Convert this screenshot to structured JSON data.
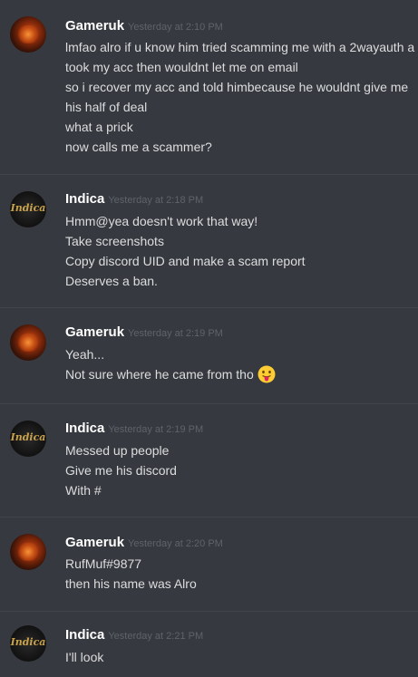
{
  "messages": [
    {
      "author": "Gameruk",
      "timestamp": "Yesterday at 2:10 PM",
      "lines": [
        "lmfao alro if u know him tried scamming me with a 2wayauth a",
        "took my acc then wouldnt let me on email",
        "so i recover my acc and told himbecause he wouldnt give me",
        "his half of deal",
        "what a prick",
        "now calls me a scammer?"
      ]
    },
    {
      "author": "Indica",
      "avatar_text": "Indica",
      "timestamp": "Yesterday at 2:18 PM",
      "lines": [
        "Hmm@yea doesn't work that way!",
        "Take screenshots",
        "Copy discord UID and make a scam report",
        "Deserves a ban."
      ]
    },
    {
      "author": "Gameruk",
      "timestamp": "Yesterday at 2:19 PM",
      "lines": [
        "Yeah...",
        "Not sure where he came from tho"
      ],
      "emoji": "tongue-out-emoji"
    },
    {
      "author": "Indica",
      "avatar_text": "Indica",
      "timestamp": "Yesterday at 2:19 PM",
      "lines": [
        "Messed up people",
        "Give me his discord",
        "With #"
      ]
    },
    {
      "author": "Gameruk",
      "timestamp": "Yesterday at 2:20 PM",
      "lines": [
        "RufMuf#9877",
        "then his name was Alro"
      ]
    },
    {
      "author": "Indica",
      "avatar_text": "Indica",
      "timestamp": "Yesterday at 2:21 PM",
      "lines": [
        "I'll look"
      ]
    }
  ],
  "colors": {
    "background": "#36393f",
    "divider": "#40444b",
    "username": "#ffffff",
    "timestamp": "#5f636a",
    "text": "#dcddde"
  }
}
